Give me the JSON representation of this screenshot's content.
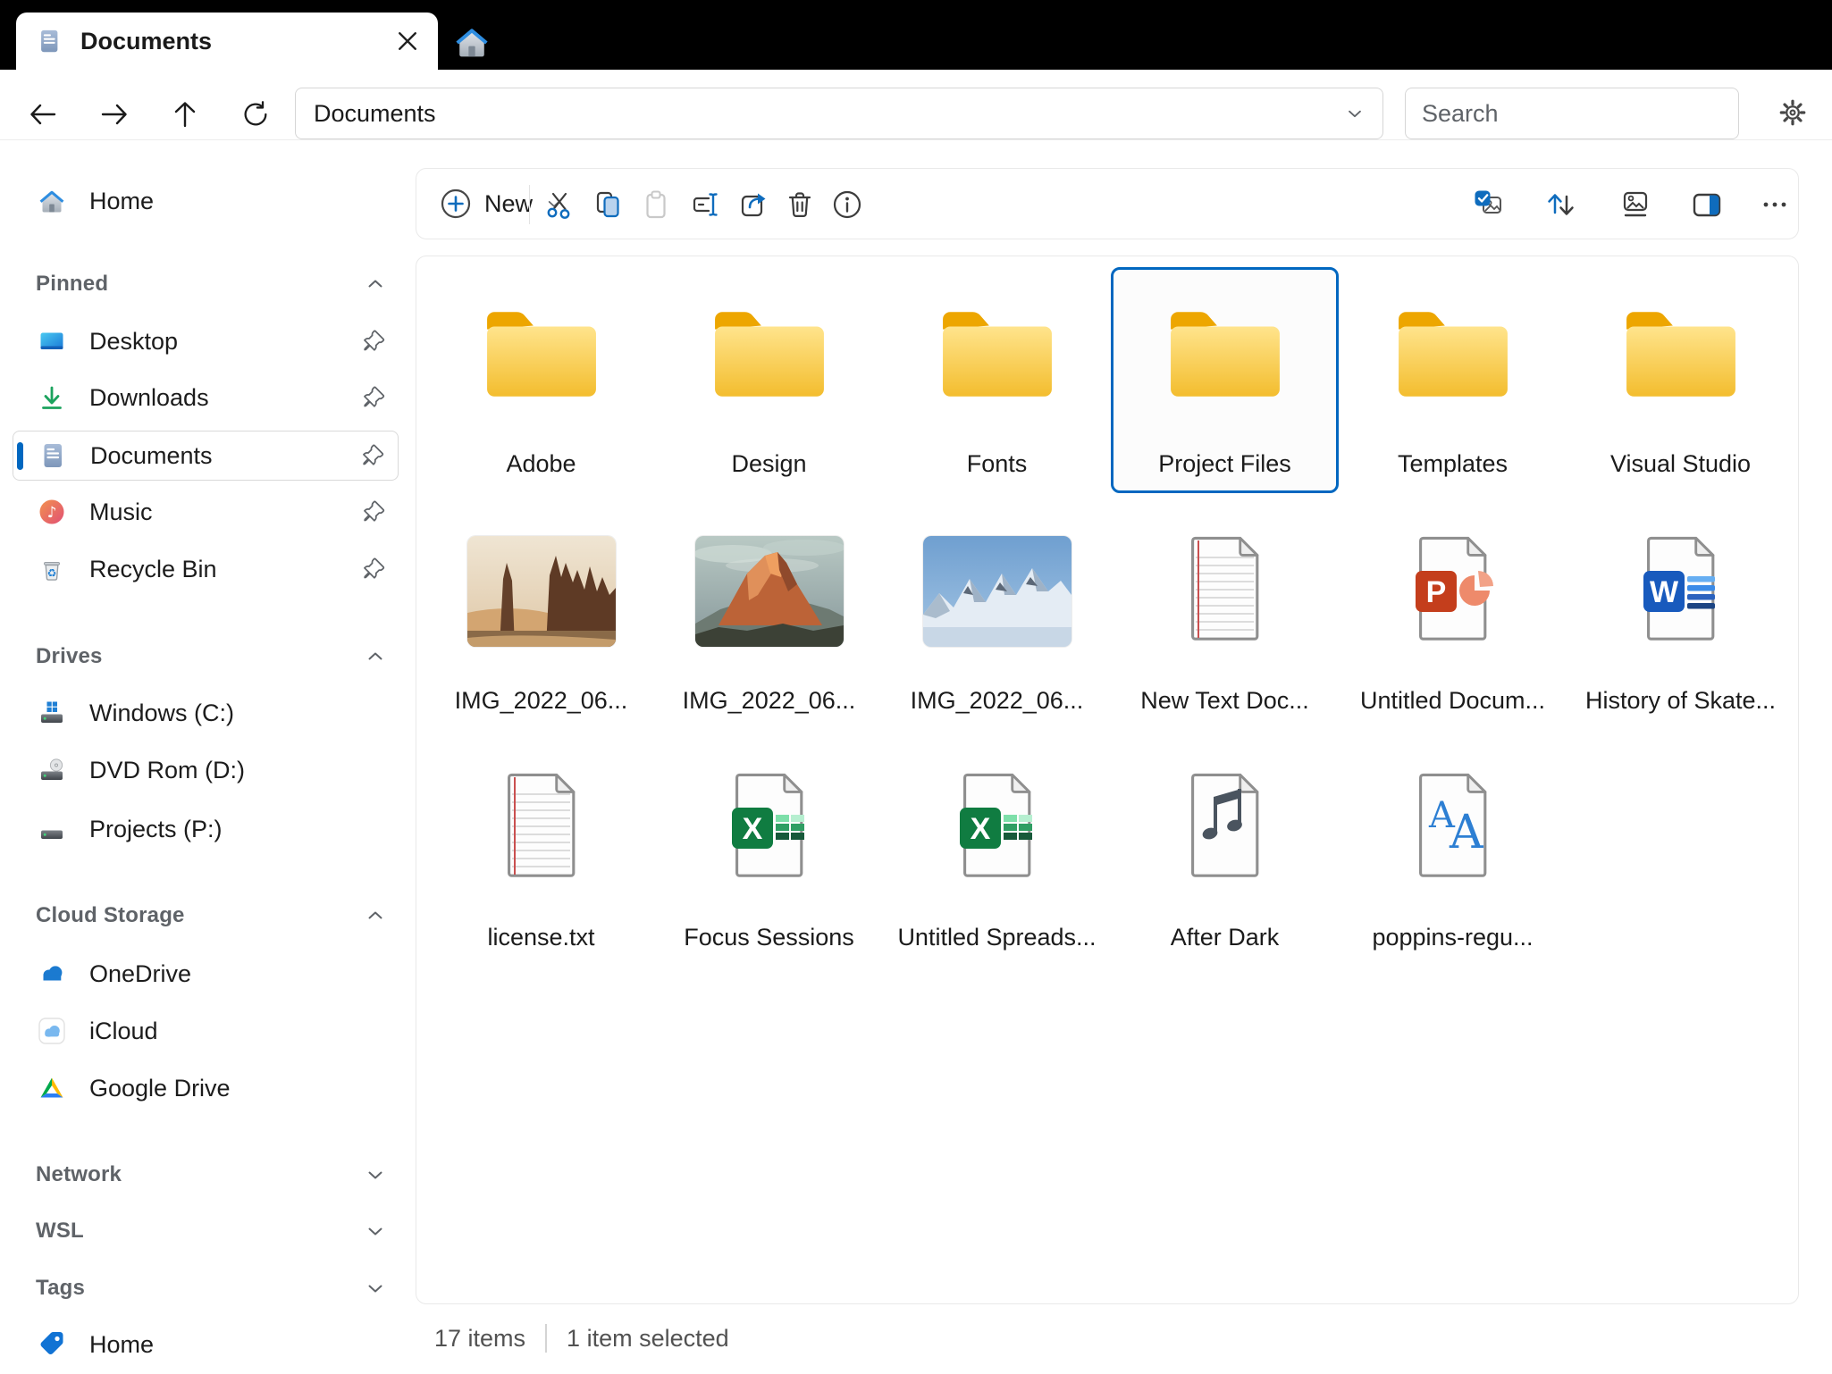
{
  "titlebar": {
    "tab": {
      "label": "Documents"
    }
  },
  "navbar": {
    "address": "Documents",
    "search_placeholder": "Search"
  },
  "toolbar": {
    "new_label": "New"
  },
  "sidebar": {
    "home": {
      "label": "Home"
    },
    "sections": [
      {
        "label": "Pinned",
        "expanded": true,
        "items": [
          {
            "label": "Desktop",
            "icon": "desktop-icon",
            "pinned": true
          },
          {
            "label": "Downloads",
            "icon": "downloads-icon",
            "pinned": true
          },
          {
            "label": "Documents",
            "icon": "document-icon",
            "pinned": true,
            "selected": true
          },
          {
            "label": "Music",
            "icon": "music-icon",
            "pinned": true
          },
          {
            "label": "Recycle Bin",
            "icon": "recycle-bin-icon",
            "pinned": true
          }
        ]
      },
      {
        "label": "Drives",
        "expanded": true,
        "items": [
          {
            "label": "Windows (C:)",
            "icon": "windows-drive-icon"
          },
          {
            "label": "DVD Rom (D:)",
            "icon": "dvd-drive-icon"
          },
          {
            "label": "Projects (P:)",
            "icon": "drive-icon"
          }
        ]
      },
      {
        "label": "Cloud Storage",
        "expanded": true,
        "items": [
          {
            "label": "OneDrive",
            "icon": "onedrive-icon"
          },
          {
            "label": "iCloud",
            "icon": "icloud-icon"
          },
          {
            "label": "Google Drive",
            "icon": "google-drive-icon"
          }
        ]
      },
      {
        "label": "Network",
        "expanded": false,
        "items": []
      },
      {
        "label": "WSL",
        "expanded": false,
        "items": []
      },
      {
        "label": "Tags",
        "expanded": false,
        "items": [
          {
            "label": "Home",
            "icon": "tag-icon"
          }
        ]
      }
    ]
  },
  "files": {
    "items": [
      {
        "name": "Adobe",
        "type": "folder"
      },
      {
        "name": "Design",
        "type": "folder"
      },
      {
        "name": "Fonts",
        "type": "folder"
      },
      {
        "name": "Project Files",
        "type": "folder",
        "selected": true
      },
      {
        "name": "Templates",
        "type": "folder"
      },
      {
        "name": "Visual Studio",
        "type": "folder"
      },
      {
        "name": "IMG_2022_06...",
        "type": "image"
      },
      {
        "name": "IMG_2022_06...",
        "type": "image"
      },
      {
        "name": "IMG_2022_06...",
        "type": "image"
      },
      {
        "name": "New Text Doc...",
        "type": "text"
      },
      {
        "name": "Untitled Docum...",
        "type": "powerpoint"
      },
      {
        "name": "History of Skate...",
        "type": "word"
      },
      {
        "name": "license.txt",
        "type": "text"
      },
      {
        "name": "Focus Sessions",
        "type": "excel"
      },
      {
        "name": "Untitled Spreads...",
        "type": "excel"
      },
      {
        "name": "After Dark",
        "type": "audio"
      },
      {
        "name": "poppins-regu...",
        "type": "font"
      }
    ]
  },
  "statusbar": {
    "count": "17 items",
    "selected": "1 item selected"
  },
  "colors": {
    "accent": "#0067c0",
    "titlebar": "#000000",
    "folder": "#f6c63d",
    "selection_border": "#0067c0"
  }
}
